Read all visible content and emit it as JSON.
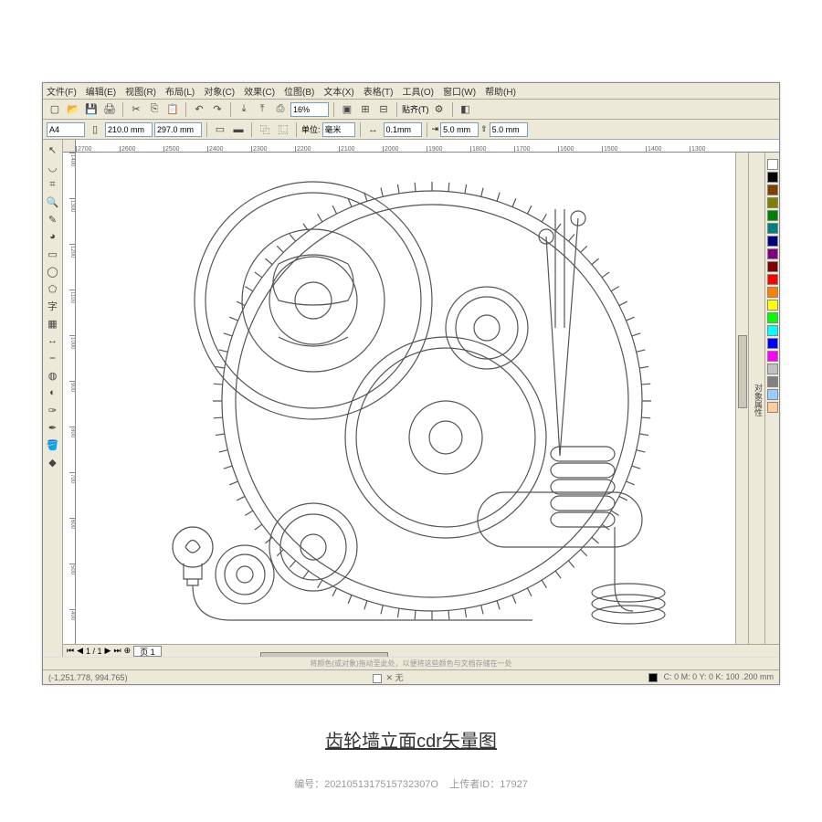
{
  "menubar": {
    "file": "文件(F)",
    "edit": "编辑(E)",
    "view": "视图(R)",
    "layout": "布局(L)",
    "object": "对象(C)",
    "effect": "效果(C)",
    "bitmap": "位图(B)",
    "text": "文本(X)",
    "table": "表格(T)",
    "tools": "工具(O)",
    "window": "窗口(W)",
    "help": "帮助(H)"
  },
  "toolbar1": {
    "zoom": "16%",
    "snap": "贴齐(T)"
  },
  "toolbar2": {
    "page_size": "A4",
    "width": "210.0 mm",
    "height": "297.0 mm",
    "units_label": "单位:",
    "units_value": "毫米",
    "nudge": "0.1mm",
    "dup_x": "5.0 mm",
    "dup_y": "5.0 mm"
  },
  "ruler_h": [
    "2700",
    "2600",
    "2500",
    "2400",
    "2300",
    "2200",
    "2100",
    "2000",
    "1900",
    "1800",
    "1700",
    "1600",
    "1500",
    "1400",
    "1300"
  ],
  "ruler_v": [
    "1400",
    "1300",
    "1200",
    "1100",
    "1000",
    "900",
    "800",
    "700",
    "600",
    "500",
    "400"
  ],
  "palette": [
    "#ffffff",
    "#000000",
    "#804000",
    "#808000",
    "#008000",
    "#008080",
    "#000080",
    "#800080",
    "#800000",
    "#ff0000",
    "#ff8000",
    "#ffff00",
    "#00ff00",
    "#00ffff",
    "#0000ff",
    "#ff00ff",
    "#c0c0c0",
    "#808080",
    "#99ccff",
    "#ffcc99"
  ],
  "page_nav": {
    "page_of": "1 / 1",
    "tab": "页 1"
  },
  "status": {
    "hint": "将颜色(或对象)拖动至此处，以便将这些颜色与文档存储在一处",
    "coords": "(-1,251.778, 994.765)",
    "fill_none": "无",
    "cmyk": "C: 0 M: 0 Y: 0 K: 100   .200 mm"
  },
  "docker": {
    "label": "对象属性"
  },
  "caption": "齿轮墙立面cdr矢量图",
  "meta": {
    "id_label": "编号：",
    "id": "2021051317515732307O",
    "uploader_label": "上传者ID：",
    "uploader": "17927"
  }
}
